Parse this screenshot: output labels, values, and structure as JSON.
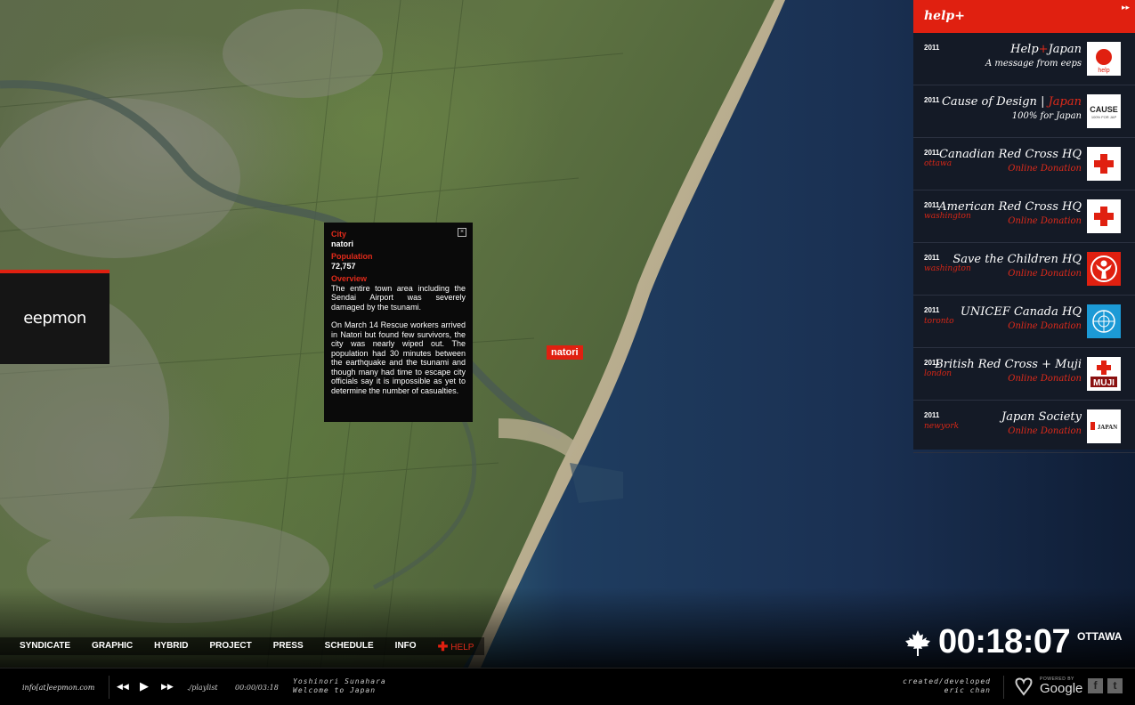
{
  "logo": {
    "text": "eepmon"
  },
  "popup": {
    "city_label": "City",
    "city_value": "natori",
    "population_label": "Population",
    "population_value": "72,757",
    "overview_label": "Overview",
    "overview_p1": "The entire town area including the Sendai Airport was severely damaged by the tsunami.",
    "overview_p2": "On March 14 Rescue workers arrived in Natori but found few survivors, the city was nearly wiped out. The population had 30 minutes between the earthquake and the tsunami and though many had time to escape city officials say it is impossible as yet to determine the number of casualties.",
    "close": "×"
  },
  "map_pin": {
    "label": "natori"
  },
  "help_panel": {
    "title": "help+",
    "collapse": "▸▸",
    "items": [
      {
        "year": "2011",
        "city": "",
        "name": "Help+Japan",
        "sub": "A message from eeps",
        "sub_red": false,
        "logo": "help"
      },
      {
        "year": "2011",
        "city": "",
        "name_a": "Cause of Design | ",
        "name_b": "Japan",
        "sub": "100% for Japan",
        "sub_red": false,
        "logo": "CAUSE"
      },
      {
        "year": "2011",
        "city": "ottawa",
        "name": "Canadian Red Cross HQ",
        "sub": "Online Donation",
        "sub_red": true,
        "logo": "red-cross"
      },
      {
        "year": "2011",
        "city": "washington",
        "name": "American Red Cross HQ",
        "sub": "Online Donation",
        "sub_red": true,
        "logo": "red-cross"
      },
      {
        "year": "2011",
        "city": "washington",
        "name": "Save the Children HQ",
        "sub": "Online Donation",
        "sub_red": true,
        "logo": "save-the-children"
      },
      {
        "year": "2011",
        "city": "toronto",
        "name": "UNICEF Canada HQ",
        "sub": "Online Donation",
        "sub_red": true,
        "logo": "unicef"
      },
      {
        "year": "2011",
        "city": "london",
        "name": "British Red Cross + Muji",
        "sub": "Online Donation",
        "sub_red": true,
        "logo": "MUJI"
      },
      {
        "year": "2011",
        "city": "newyork",
        "name": "Japan Society",
        "sub": "Online Donation",
        "sub_red": true,
        "logo": "JAPAN"
      }
    ]
  },
  "help_logo_text": {
    "help": "help",
    "cause": "CAUSE",
    "cause_small": "100% FOR JAP",
    "muji": "MUJI",
    "japan": "JAPAN"
  },
  "clock": {
    "time": "00:18:07",
    "city": "OTTAWA"
  },
  "nav": {
    "items": [
      "SYNDICATE",
      "GRAPHIC",
      "HYBRID",
      "PROJECT",
      "PRESS",
      "SCHEDULE",
      "INFO"
    ],
    "help_plus": "✚",
    "help": "HELP"
  },
  "footer": {
    "email": "info[at]eepmon.com",
    "prev": "◀◀",
    "play": "▶",
    "next": "▶▶",
    "playlist": "./playlist",
    "time": "00:00/03:18",
    "track_line1": "Yoshinori Sunahara",
    "track_line2": "Welcome to Japan",
    "credit_line1": "created/developed",
    "credit_line2": "eric chan",
    "powered": "POWERED BY",
    "google": "Google",
    "facebook": "f",
    "twitter": "t"
  },
  "colors": {
    "accent": "#e02010",
    "panel": "#141a26",
    "ocean": "#1c2f4e"
  }
}
